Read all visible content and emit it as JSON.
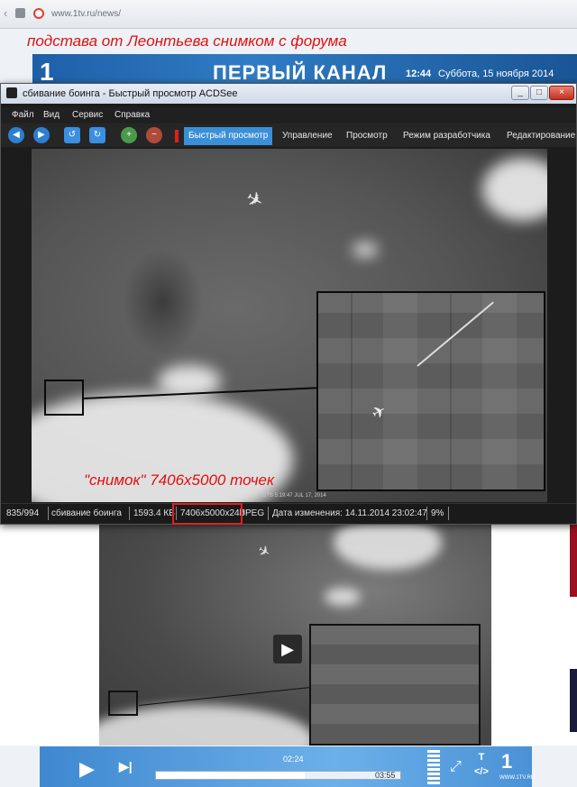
{
  "browser": {
    "url": "www.1tv.ru/news/"
  },
  "headline": "подстава от Леонтьева снимком с форума",
  "site": {
    "channel": "ПЕРВЫЙ КАНАЛ",
    "time": "12:44",
    "date": "Суббота, 15 ноября 2014",
    "logo": "1"
  },
  "window": {
    "title": "сбивание боинга - Быстрый просмотр ACDSee",
    "buttons": [
      "_",
      "□",
      "×"
    ]
  },
  "menu": [
    "Файл",
    "Вид",
    "Сервис",
    "Справка"
  ],
  "toolbar": {
    "tabs": [
      "Быстрый просмотр",
      "Управление",
      "Просмотр",
      "Режим разработчика",
      "Редактирование"
    ],
    "active_tab": "Быстрый просмотр"
  },
  "image": {
    "caption": "\"снимок\" 7406x5000 точек",
    "stamp": "DTS 5:19:47    JUL 17, 2014"
  },
  "status": {
    "index": "835/994",
    "name": "сбивание боинга",
    "size": "1593.4 КБ",
    "dimensions": "7406x5000x24b",
    "format": "JPEG",
    "modified": "Дата изменения: 14.11.2014 23:02:47",
    "zoom": "9%"
  },
  "player": {
    "current": "02:24",
    "duration": "03:55",
    "progress": 0.61,
    "site": "WWW.1TV.RU",
    "embed_label": "T"
  },
  "icons": [
    "page-icon",
    "site-icon",
    "back-icon",
    "forward-icon",
    "rotate-left-icon",
    "rotate-right-icon",
    "zoom-in-icon",
    "zoom-out-icon",
    "play-icon",
    "next-icon",
    "volume-icon",
    "fullscreen-icon",
    "embed-icon",
    "channel-logo-icon",
    "plane-icon"
  ],
  "colors": {
    "annotation": "#e01010",
    "active_tab": "#3b8fd6",
    "player": "#4a92d6"
  }
}
